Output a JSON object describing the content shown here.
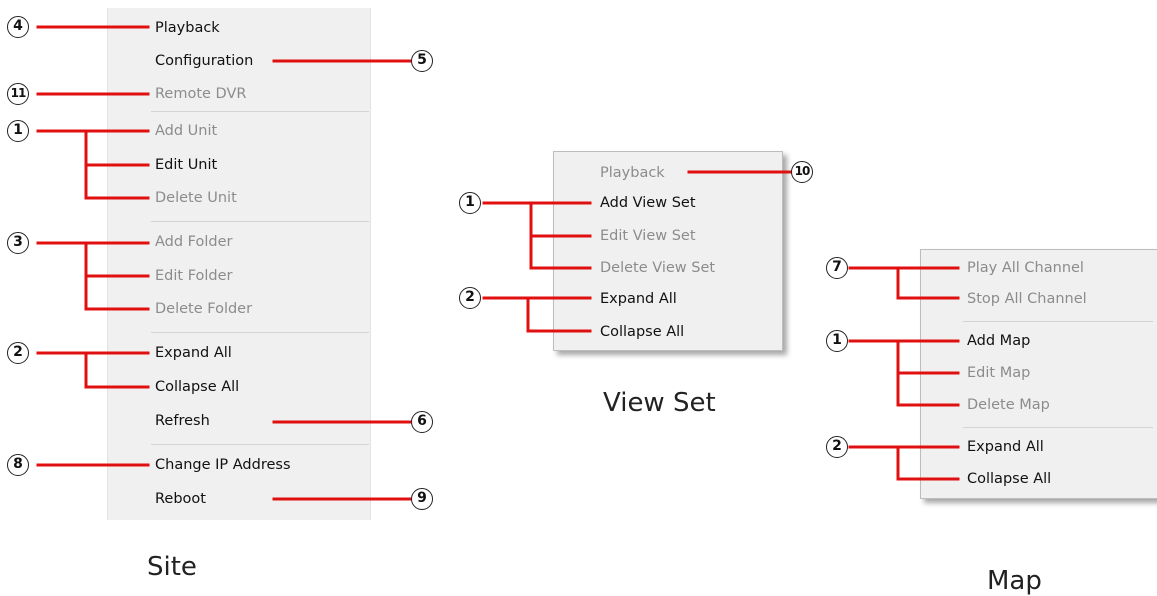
{
  "site": {
    "caption": "Site",
    "items": [
      {
        "label": "Playback",
        "enabled": true
      },
      {
        "label": "Configuration",
        "enabled": true
      },
      {
        "label": "Remote DVR",
        "enabled": false
      },
      {
        "label": "Add Unit",
        "enabled": false
      },
      {
        "label": "Edit Unit",
        "enabled": true
      },
      {
        "label": "Delete Unit",
        "enabled": false
      },
      {
        "label": "Add Folder",
        "enabled": false
      },
      {
        "label": "Edit Folder",
        "enabled": false
      },
      {
        "label": "Delete Folder",
        "enabled": false
      },
      {
        "label": "Expand All",
        "enabled": true
      },
      {
        "label": "Collapse All",
        "enabled": true
      },
      {
        "label": "Refresh",
        "enabled": true
      },
      {
        "label": "Change IP Address",
        "enabled": true
      },
      {
        "label": "Reboot",
        "enabled": true
      }
    ],
    "callouts": [
      "4",
      "5",
      "11",
      "1",
      "3",
      "2",
      "6",
      "8",
      "9"
    ]
  },
  "view_set": {
    "caption": "View Set",
    "items": [
      {
        "label": "Playback",
        "enabled": false
      },
      {
        "label": "Add View Set",
        "enabled": true
      },
      {
        "label": "Edit View Set",
        "enabled": false
      },
      {
        "label": "Delete View Set",
        "enabled": false
      },
      {
        "label": "Expand All",
        "enabled": true
      },
      {
        "label": "Collapse All",
        "enabled": true
      }
    ],
    "callouts": [
      "10",
      "1",
      "2"
    ]
  },
  "map": {
    "caption": "Map",
    "items": [
      {
        "label": "Play All Channel",
        "enabled": false
      },
      {
        "label": "Stop All Channel",
        "enabled": false
      },
      {
        "label": "Add Map",
        "enabled": true
      },
      {
        "label": "Edit Map",
        "enabled": false
      },
      {
        "label": "Delete Map",
        "enabled": false
      },
      {
        "label": "Expand All",
        "enabled": true
      },
      {
        "label": "Collapse All",
        "enabled": true
      }
    ],
    "callouts": [
      "7",
      "1",
      "2"
    ]
  },
  "colors": {
    "annotation_line": "#e01010",
    "menu_background": "#f0f0f0",
    "enabled_text": "#111111",
    "disabled_text": "#8c8c8c"
  }
}
